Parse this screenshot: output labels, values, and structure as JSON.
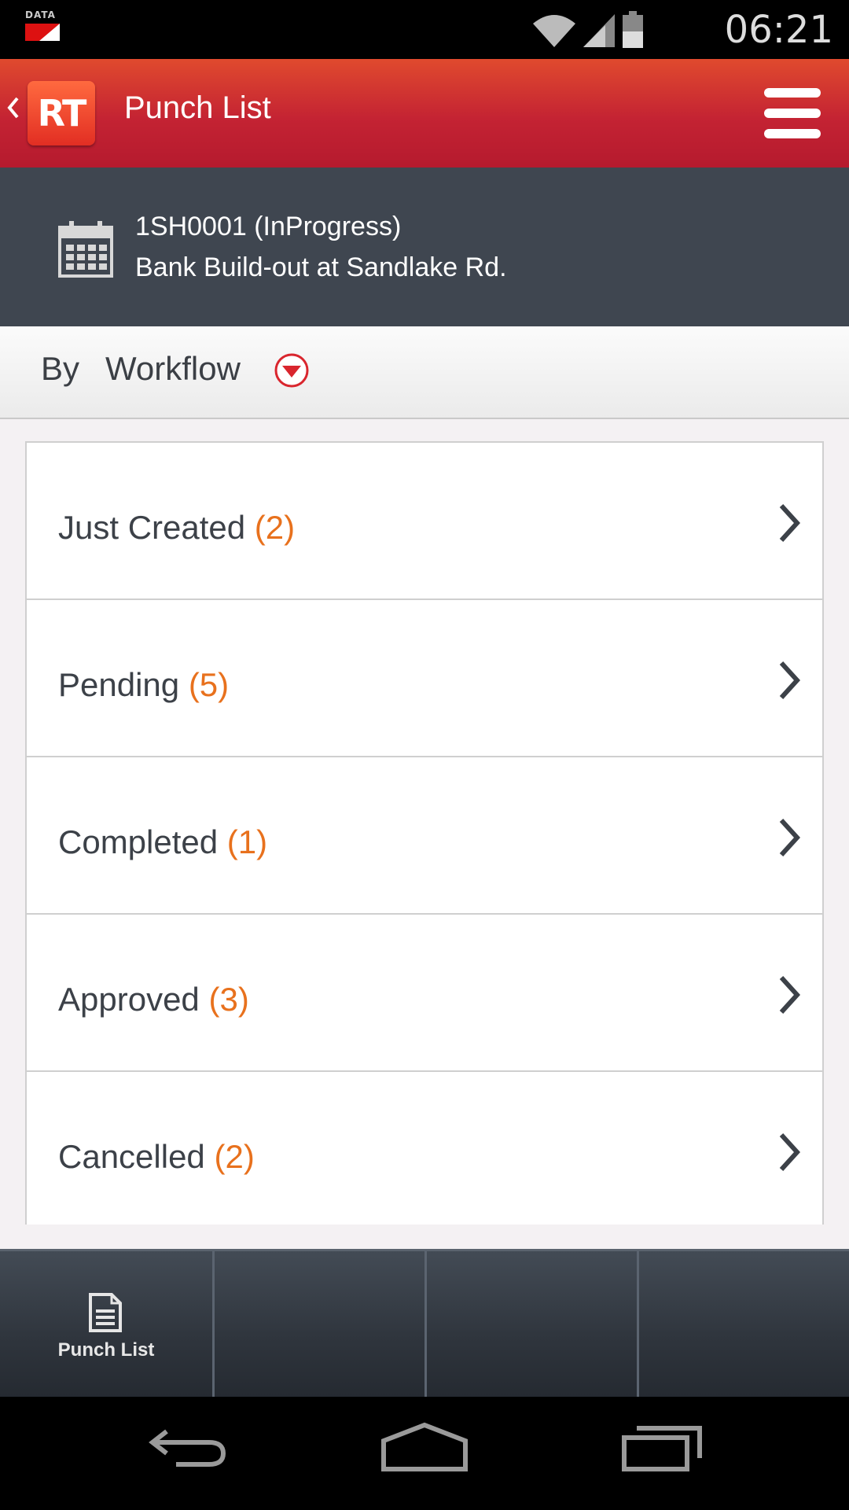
{
  "status_bar": {
    "data_label": "DATA",
    "time": "06:21"
  },
  "header": {
    "logo_text": "RT",
    "title": "Punch List"
  },
  "project": {
    "line1": "1SH0001 (InProgress)",
    "line2": "Bank Build-out at Sandlake Rd."
  },
  "filter": {
    "prefix": "By",
    "value": "Workflow"
  },
  "list": [
    {
      "label": "Just Created",
      "count": "(2)"
    },
    {
      "label": "Pending",
      "count": "(5)"
    },
    {
      "label": "Completed",
      "count": "(1)"
    },
    {
      "label": "Approved",
      "count": "(3)"
    },
    {
      "label": "Cancelled",
      "count": "(2)"
    }
  ],
  "tabs": [
    {
      "label": "Punch List"
    }
  ],
  "colors": {
    "header_red": "#c42333",
    "banner_dark": "#3f4650",
    "count_orange": "#e8711d",
    "text_dark": "#3c4148"
  }
}
